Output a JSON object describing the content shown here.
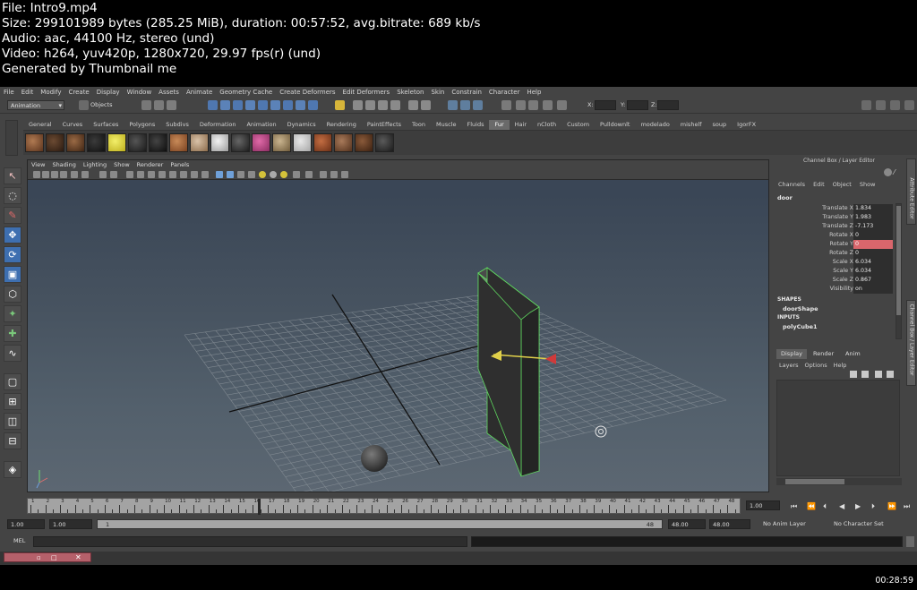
{
  "info": {
    "line1": "File: Intro9.mp4",
    "line2": "Size: 299101989 bytes (285.25 MiB), duration: 00:57:52, avg.bitrate: 689 kb/s",
    "line3": "Audio: aac, 44100 Hz, stereo (und)",
    "line4": "Video: h264, yuv420p, 1280x720, 29.97 fps(r) (und)",
    "line5": "Generated by Thumbnail me"
  },
  "menu": [
    "File",
    "Edit",
    "Modify",
    "Create",
    "Display",
    "Window",
    "Assets",
    "Animate",
    "Geometry Cache",
    "Create Deformers",
    "Edit Deformers",
    "Skeleton",
    "Skin",
    "Constrain",
    "Character",
    "Help"
  ],
  "statusline": {
    "mode": "Animation",
    "selection_mode": "Objects",
    "x_label": "X:",
    "y_label": "Y:",
    "z_label": "Z:"
  },
  "shelf_tabs": [
    "General",
    "Curves",
    "Surfaces",
    "Polygons",
    "Subdivs",
    "Deformation",
    "Animation",
    "Dynamics",
    "Rendering",
    "PaintEffects",
    "Toon",
    "Muscle",
    "Fluids",
    "Fur",
    "Hair",
    "nCloth",
    "Custom",
    "Pulldownlt",
    "modelado",
    "mishelf",
    "soup",
    "IgorFX"
  ],
  "shelf_active_tab": "Fur",
  "viewport_menu": [
    "View",
    "Shading",
    "Lighting",
    "Show",
    "Renderer",
    "Panels"
  ],
  "channel_box": {
    "title": "Channel Box / Layer Editor",
    "menu": [
      "Channels",
      "Edit",
      "Object",
      "Show"
    ],
    "object": "door",
    "attributes": [
      {
        "label": "Translate X",
        "value": "1.834"
      },
      {
        "label": "Translate Y",
        "value": "1.983"
      },
      {
        "label": "Translate Z",
        "value": "-7.173"
      },
      {
        "label": "Rotate X",
        "value": "0"
      },
      {
        "label": "Rotate Y",
        "value": "0"
      },
      {
        "label": "Rotate Z",
        "value": "0"
      },
      {
        "label": "Scale X",
        "value": "6.034"
      },
      {
        "label": "Scale Y",
        "value": "6.034"
      },
      {
        "label": "Scale Z",
        "value": "0.867"
      },
      {
        "label": "Visibility",
        "value": "on"
      }
    ],
    "highlighted_attribute": "Rotate Y",
    "shapes_header": "SHAPES",
    "shape_name": "doorShape",
    "inputs_header": "INPUTS",
    "input_name": "polyCube1"
  },
  "layer_editor": {
    "tabs": [
      "Display",
      "Render",
      "Anim"
    ],
    "active_tab": "Display",
    "menu": [
      "Layers",
      "Options",
      "Help"
    ]
  },
  "side_tabs": [
    "Attribute Editor",
    "Channel Box / Layer Editor"
  ],
  "time_slider": {
    "ticks": [
      "1",
      "2",
      "3",
      "4",
      "5",
      "6",
      "7",
      "8",
      "9",
      "10",
      "11",
      "12",
      "13",
      "14",
      "15",
      "16",
      "17",
      "18",
      "19",
      "20",
      "21",
      "22",
      "23",
      "24",
      "25",
      "26",
      "27",
      "28",
      "29",
      "30",
      "31",
      "32",
      "33",
      "34",
      "35",
      "36",
      "37",
      "38",
      "39",
      "40",
      "41",
      "42",
      "43",
      "44",
      "45",
      "46",
      "47",
      "48"
    ],
    "current_frame": "1.00"
  },
  "range_slider": {
    "start": "1.00",
    "playback_start": "1.00",
    "range_start": "1",
    "range_end": "48",
    "playback_end": "48.00",
    "end": "48.00",
    "anim_layer": "No Anim Layer",
    "character_set": "No Character Set"
  },
  "command_line": {
    "label": "MEL"
  },
  "timestamp": "00:28:59"
}
